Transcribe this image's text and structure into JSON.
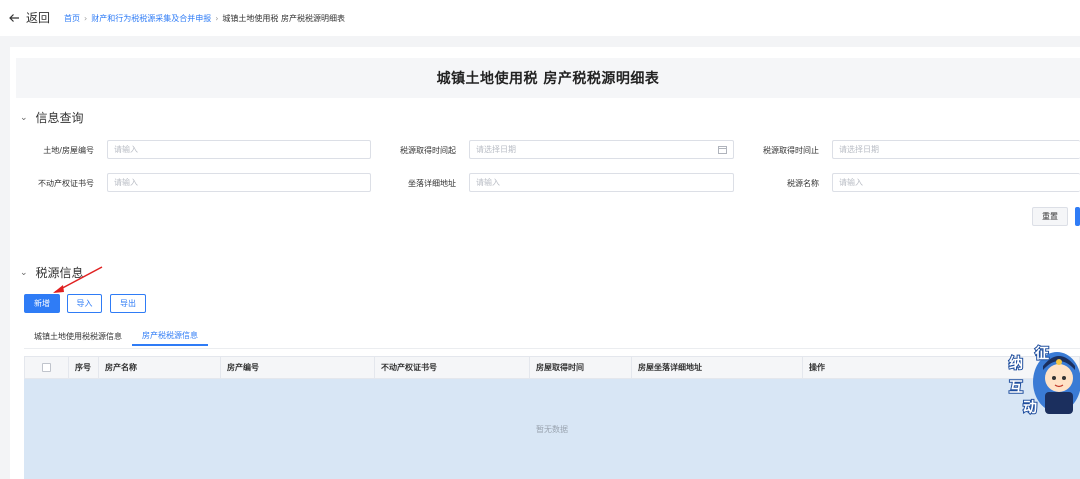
{
  "header": {
    "back_label": "返回",
    "breadcrumb": [
      "首页",
      "财产和行为税税源采集及合并申报",
      "城镇土地使用税 房产税税源明细表"
    ]
  },
  "page_title": "城镇土地使用税 房产税税源明细表",
  "query_section": {
    "title": "信息查询",
    "fields": [
      {
        "label": "土地/房屋编号",
        "placeholder": "请输入"
      },
      {
        "label": "税源取得时间起",
        "placeholder": "请选择日期"
      },
      {
        "label": "税源取得时间止",
        "placeholder": "请选择日期"
      },
      {
        "label": "不动产权证书号",
        "placeholder": "请输入"
      },
      {
        "label": "坐落详细地址",
        "placeholder": "请输入"
      },
      {
        "label": "税源名称",
        "placeholder": "请输入"
      }
    ],
    "reset_label": "重置"
  },
  "source_section": {
    "title": "税源信息",
    "buttons": {
      "add": "新增",
      "import": "导入",
      "export": "导出"
    },
    "tabs": [
      "城镇土地使用税税源信息",
      "房产税税源信息"
    ],
    "active_tab": 1,
    "table": {
      "columns": [
        "序号",
        "房产名称",
        "房产编号",
        "不动产权证书号",
        "房屋取得时间",
        "房屋坐落详细地址",
        "操作"
      ],
      "empty_text": "暂无数据"
    }
  },
  "mascot": {
    "chars": [
      "征",
      "纳",
      "互",
      "动"
    ]
  },
  "colors": {
    "accent": "#2f7cf6",
    "annotation": "#e02020",
    "empty_bg": "#d8e6f5"
  }
}
